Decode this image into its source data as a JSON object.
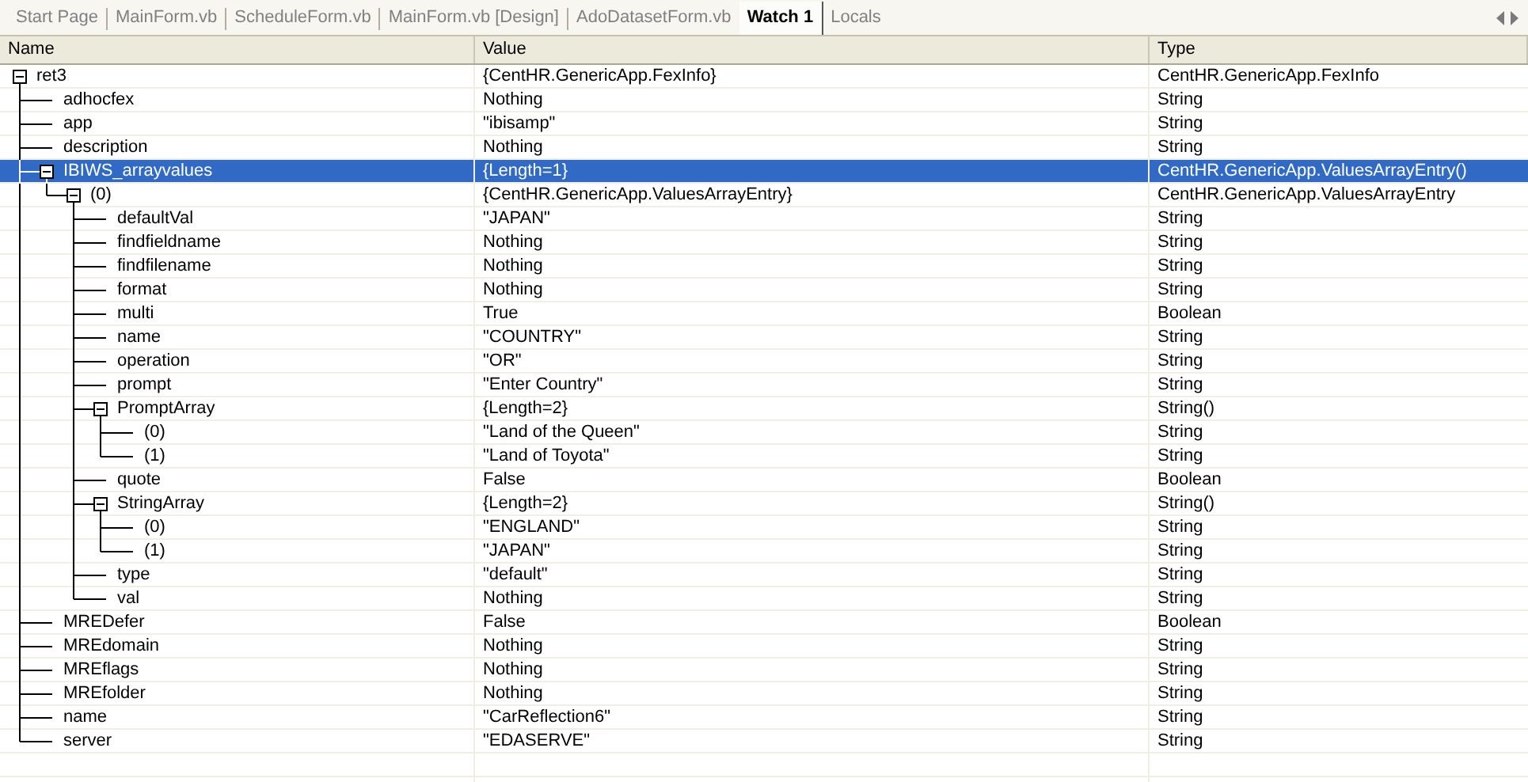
{
  "tabs": [
    {
      "label": "Start Page",
      "selected": false
    },
    {
      "label": "MainForm.vb",
      "selected": false
    },
    {
      "label": "ScheduleForm.vb",
      "selected": false
    },
    {
      "label": "MainForm.vb [Design]",
      "selected": false
    },
    {
      "label": "AdoDatasetForm.vb",
      "selected": false
    },
    {
      "label": "Watch 1",
      "selected": true
    },
    {
      "label": "Locals",
      "selected": false
    }
  ],
  "columns": [
    "Name",
    "Value",
    "Type"
  ],
  "rows": [
    {
      "name": "ret3",
      "value": "{CentHR.GenericApp.FexInfo}",
      "type": "CentHR.GenericApp.FexInfo",
      "selected": false,
      "expanded": true,
      "children": [
        {
          "name": "adhocfex",
          "value": "Nothing",
          "type": "String",
          "selected": false
        },
        {
          "name": "app",
          "value": "\"ibisamp\"",
          "type": "String",
          "selected": false
        },
        {
          "name": "description",
          "value": "Nothing",
          "type": "String",
          "selected": false
        },
        {
          "name": "IBIWS_arrayvalues",
          "value": "{Length=1}",
          "type": "CentHR.GenericApp.ValuesArrayEntry()",
          "selected": true,
          "expanded": true,
          "children": [
            {
              "name": "(0)",
              "value": "{CentHR.GenericApp.ValuesArrayEntry}",
              "type": "CentHR.GenericApp.ValuesArrayEntry",
              "selected": false,
              "expanded": true,
              "children": [
                {
                  "name": "defaultVal",
                  "value": "\"JAPAN\"",
                  "type": "String",
                  "selected": false
                },
                {
                  "name": "findfieldname",
                  "value": "Nothing",
                  "type": "String",
                  "selected": false
                },
                {
                  "name": "findfilename",
                  "value": "Nothing",
                  "type": "String",
                  "selected": false
                },
                {
                  "name": "format",
                  "value": "Nothing",
                  "type": "String",
                  "selected": false
                },
                {
                  "name": "multi",
                  "value": "True",
                  "type": "Boolean",
                  "selected": false
                },
                {
                  "name": "name",
                  "value": "\"COUNTRY\"",
                  "type": "String",
                  "selected": false
                },
                {
                  "name": "operation",
                  "value": "\"OR\"",
                  "type": "String",
                  "selected": false
                },
                {
                  "name": "prompt",
                  "value": "\"Enter Country\"",
                  "type": "String",
                  "selected": false
                },
                {
                  "name": "PromptArray",
                  "value": "{Length=2}",
                  "type": "String()",
                  "selected": false,
                  "expanded": true,
                  "children": [
                    {
                      "name": "(0)",
                      "value": "\"Land of the Queen\"",
                      "type": "String",
                      "selected": false
                    },
                    {
                      "name": "(1)",
                      "value": "\"Land of Toyota\"",
                      "type": "String",
                      "selected": false
                    }
                  ]
                },
                {
                  "name": "quote",
                  "value": "False",
                  "type": "Boolean",
                  "selected": false
                },
                {
                  "name": "StringArray",
                  "value": "{Length=2}",
                  "type": "String()",
                  "selected": false,
                  "expanded": true,
                  "children": [
                    {
                      "name": "(0)",
                      "value": "\"ENGLAND\"",
                      "type": "String",
                      "selected": false
                    },
                    {
                      "name": "(1)",
                      "value": "\"JAPAN\"",
                      "type": "String",
                      "selected": false
                    }
                  ]
                },
                {
                  "name": "type",
                  "value": "\"default\"",
                  "type": "String",
                  "selected": false
                },
                {
                  "name": "val",
                  "value": "Nothing",
                  "type": "String",
                  "selected": false
                }
              ]
            }
          ]
        },
        {
          "name": "MREDefer",
          "value": "False",
          "type": "Boolean",
          "selected": false
        },
        {
          "name": "MREdomain",
          "value": "Nothing",
          "type": "String",
          "selected": false
        },
        {
          "name": "MREflags",
          "value": "Nothing",
          "type": "String",
          "selected": false
        },
        {
          "name": "MREfolder",
          "value": "Nothing",
          "type": "String",
          "selected": false
        },
        {
          "name": "name",
          "value": "\"CarReflection6\"",
          "type": "String",
          "selected": false
        },
        {
          "name": "server",
          "value": "\"EDASERVE\"",
          "type": "String",
          "selected": false
        }
      ]
    }
  ]
}
